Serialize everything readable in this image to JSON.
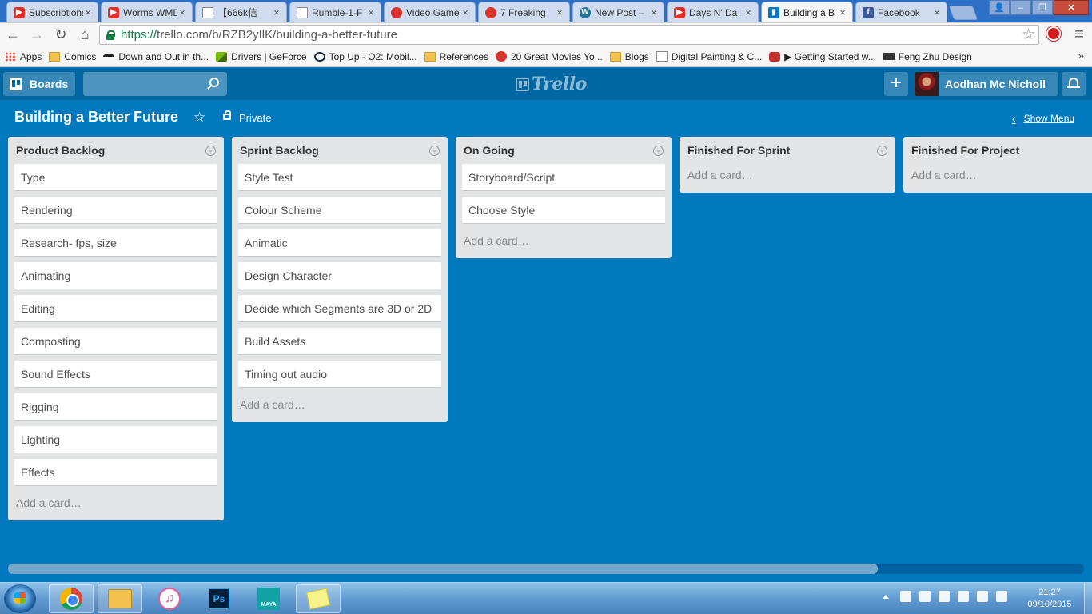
{
  "browser": {
    "tabs": [
      {
        "title": "Subscriptions",
        "favicon": "youtube-icon",
        "active": false
      },
      {
        "title": "Worms WMD",
        "favicon": "youtube-icon",
        "active": false
      },
      {
        "title": "【666k信",
        "favicon": "document-icon",
        "active": false
      },
      {
        "title": "Rumble-1-F",
        "favicon": "document-icon",
        "active": false
      },
      {
        "title": "Video Game",
        "favicon": "gamespot-icon",
        "active": false
      },
      {
        "title": "7 Freaking",
        "favicon": "gamespot-icon",
        "active": false
      },
      {
        "title": "New Post –",
        "favicon": "wordpress-icon",
        "active": false
      },
      {
        "title": "Days N' Da",
        "favicon": "youtube-icon",
        "active": false
      },
      {
        "title": "Building a B",
        "favicon": "trello-icon",
        "active": true
      },
      {
        "title": "Facebook",
        "favicon": "facebook-icon",
        "active": false
      }
    ],
    "url_scheme": "https://",
    "url_rest": "trello.com/b/RZB2yIlK/building-a-better-future",
    "bookmarks": [
      {
        "label": "Apps",
        "icon": "apps-icon"
      },
      {
        "label": "Comics",
        "icon": "folder-icon"
      },
      {
        "label": "Down and Out in th...",
        "icon": "glasses-icon"
      },
      {
        "label": "Drivers | GeForce",
        "icon": "nvidia-icon"
      },
      {
        "label": "Top Up - O2: Mobil...",
        "icon": "o2-icon"
      },
      {
        "label": "References",
        "icon": "folder-icon"
      },
      {
        "label": "20 Great Movies Yo...",
        "icon": "gamespot-icon"
      },
      {
        "label": "Blogs",
        "icon": "folder-icon"
      },
      {
        "label": "Digital Painting & C...",
        "icon": "page-icon"
      },
      {
        "label": "▶ Getting Started w...",
        "icon": "youtube-icon"
      },
      {
        "label": "Feng Zhu Design",
        "icon": "fengzhu-icon"
      }
    ],
    "bookmarks_overflow": "»"
  },
  "trello": {
    "boards_label": "Boards",
    "search_placeholder": "",
    "logo_text": "Trello",
    "add_label": "+",
    "member_name": "Aodhan Mc Nicholl"
  },
  "board": {
    "title": "Building a Better Future",
    "star": "☆",
    "visibility": "Private",
    "show_menu": "Show Menu",
    "lists": [
      {
        "title": "Product Backlog",
        "cards": [
          "Type",
          "Rendering",
          "Research- fps, size",
          "Animating",
          "Editing",
          "Composting",
          "Sound Effects",
          "Rigging",
          "Lighting",
          "Effects"
        ],
        "add_card": "Add a card…"
      },
      {
        "title": "Sprint Backlog",
        "cards": [
          "Style Test",
          "Colour Scheme",
          "Animatic",
          "Design Character",
          "Decide which Segments are 3D or 2D",
          "Build Assets",
          "Timing out audio"
        ],
        "add_card": "Add a card…"
      },
      {
        "title": "On Going",
        "cards": [
          "Storyboard/Script",
          "Choose Style"
        ],
        "add_card": "Add a card…"
      },
      {
        "title": "Finished For Sprint",
        "cards": [],
        "add_card": "Add a card…"
      },
      {
        "title": "Finished For Project",
        "cards": [],
        "add_card": "Add a card…"
      }
    ]
  },
  "taskbar": {
    "apps": [
      "chrome-icon",
      "file-explorer-icon",
      "itunes-icon",
      "photoshop-icon",
      "maya-icon",
      "sticky-notes-icon"
    ],
    "photoshop_label": "Ps",
    "maya_label": "MAYA",
    "time": "21:27",
    "date": "09/10/2015"
  },
  "colors": {
    "board_background": "#0079bf",
    "header_background": "#0067a3",
    "list_background": "#e2e4e6"
  }
}
